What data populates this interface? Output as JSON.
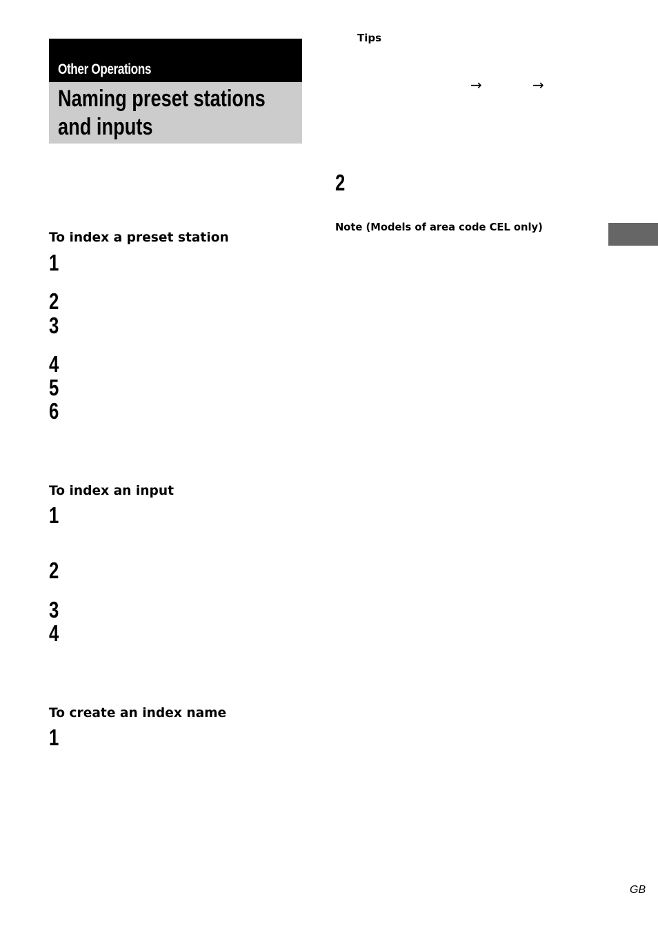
{
  "header": {
    "section": "Other Operations",
    "title_line1": "Naming preset stations",
    "title_line2": "and inputs"
  },
  "sections": [
    {
      "heading": "To index a preset station",
      "steps": [
        "1",
        "2",
        "3",
        "4",
        "5",
        "6"
      ]
    },
    {
      "heading": "To index an input",
      "steps": [
        "1",
        "2",
        "3",
        "4"
      ]
    },
    {
      "heading": "To create an index name",
      "steps": [
        "1"
      ]
    }
  ],
  "right_column": {
    "tips_label": "Tips",
    "arrows": [
      "→",
      "→"
    ],
    "step": "2",
    "note_label": "Note (Models of area code CEL only)"
  },
  "footer": {
    "locale": "GB"
  },
  "colors": {
    "section_bar": "#000000",
    "title_bar": "#cccccc",
    "side_tab": "#666666"
  }
}
